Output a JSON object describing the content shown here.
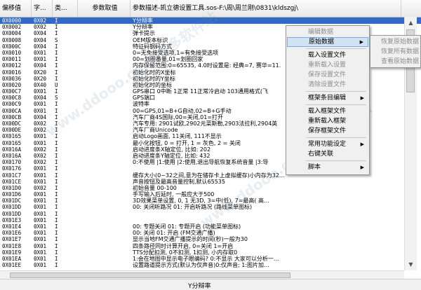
{
  "header": {
    "col0": "偏移值",
    "col1": "字...",
    "col2": "类...",
    "col3": "参数取值",
    "col4": "参数描述-凯立德设置工具.sos-F:\\周\\周兰刚\\0831\\kldszgj\\"
  },
  "rows": [
    {
      "offset": "0X0000",
      "size": "0X02",
      "type": "I",
      "value": "",
      "desc": "Y分辩率"
    },
    {
      "offset": "0X0002",
      "size": "0X02",
      "type": "I",
      "value": "",
      "desc": "Y分辩率"
    },
    {
      "offset": "0X0004",
      "size": "0X04",
      "type": "I",
      "value": "",
      "desc": "弹卡提示"
    },
    {
      "offset": "0X0008",
      "size": "0X04",
      "type": "S",
      "value": "",
      "desc": "OEM版本标识"
    },
    {
      "offset": "0X000C",
      "size": "0X04",
      "type": "I",
      "value": "",
      "desc": "特征码钢码方式"
    },
    {
      "offset": "0X0010",
      "size": "0X01",
      "type": "I",
      "value": "",
      "desc": "0=无免接受选项,1=有免接受选项"
    },
    {
      "offset": "0X0011",
      "size": "0X01",
      "type": "I",
      "value": "",
      "desc": "00=划圈番量,01=划圈回家"
    },
    {
      "offset": "0X0012",
      "size": "0X04",
      "type": "I",
      "value": "",
      "desc": "内存保留范围:0=65535, 4.0时设置是: 经典=7, 赛华=11."
    },
    {
      "offset": "0X0016",
      "size": "0X20",
      "type": "I",
      "value": "",
      "desc": "初始化时的X坐标"
    },
    {
      "offset": "0X0036",
      "size": "0X20",
      "type": "I",
      "value": "",
      "desc": "初始化时的Y坐标"
    },
    {
      "offset": "0X0020",
      "size": "0X40",
      "type": "U",
      "value": "",
      "desc": "初始化时的坐标"
    },
    {
      "offset": "0X00C7",
      "size": "0X01",
      "type": "I",
      "value": "",
      "desc": "GPS串口 0中断 1正常 11正常冷启动 103通用格式(飞"
    },
    {
      "offset": "0X00C8",
      "size": "0X04",
      "type": "S",
      "value": "",
      "desc": "GPS端口"
    },
    {
      "offset": "0X00C9",
      "size": "0X01",
      "type": "I",
      "value": "",
      "desc": "波特率"
    },
    {
      "offset": "0X00CA",
      "size": "0X01",
      "type": "I",
      "value": "",
      "desc": "00=GPS,01=B+G自动,02=B+G手动"
    },
    {
      "offset": "0X00CB",
      "size": "0X04",
      "type": "I",
      "value": "",
      "desc": "汽车厂商4S国际,00=关闭,01=打开"
    },
    {
      "offset": "0X00DC",
      "size": "0X02",
      "type": "I",
      "value": "",
      "desc": "汽车专用: 2901试欧,2902元菜斯勒,2903法拉利,2904英"
    },
    {
      "offset": "0X00DE",
      "size": "0X02",
      "type": "I",
      "value": "",
      "desc": "汽车厂商Unicode"
    },
    {
      "offset": "0X0165",
      "size": "0X01",
      "type": "I",
      "value": "",
      "desc": "启动Logo画面, 11关闭, 111不显示"
    },
    {
      "offset": "0X0165",
      "size": "0X01",
      "type": "I",
      "value": "",
      "desc": "最小化按钮, 0 = 打开, 1 = 灰色, 2 = 关闭"
    },
    {
      "offset": "0X016A",
      "size": "0X02",
      "type": "I",
      "value": "",
      "desc": "启动进度条X轴定位, 比如: 202"
    },
    {
      "offset": "0X016A",
      "size": "0X02",
      "type": "I",
      "value": "",
      "desc": "启动进度条Y轴定位, 比如: 432"
    },
    {
      "offset": "0X0170",
      "size": "0X02",
      "type": "I",
      "value": "",
      "desc": "0:不使用 |1:使用 |2:使用,退出导航恢复系统音量 |3:导"
    },
    {
      "offset": "0X0176",
      "size": "0X01",
      "type": "I",
      "value": "",
      "desc": ""
    },
    {
      "offset": "0X01C7",
      "size": "0X01",
      "type": "I",
      "value": "",
      "desc": "缓存大小(0~32之间,意为在储存卡上虚拟缓存)小内存为32..."
    },
    {
      "offset": "0X01CE",
      "size": "0X01",
      "type": "I",
      "value": "",
      "desc": "声音按钮及最高音量控制,默认65535"
    },
    {
      "offset": "0X01D0",
      "size": "0X02",
      "type": "I",
      "value": "",
      "desc": "初始音量 00-100"
    },
    {
      "offset": "0X01D6",
      "size": "0X01",
      "type": "I",
      "value": "",
      "desc": "手写输入后延时, 一般应大于500"
    },
    {
      "offset": "0X01DC",
      "size": "0X01",
      "type": "I",
      "value": "",
      "desc": "3D效果菜单设置, 0, 1 无3D, 3=中(低), 7=最高( 高..."
    },
    {
      "offset": "0X01DD",
      "size": "0X01",
      "type": "I",
      "value": "",
      "desc": "00: 关闭听路况   01: 开启听路况 (路线菜单图标)"
    },
    {
      "offset": "0X01DD",
      "size": "0X01",
      "type": "I",
      "value": "",
      "desc": ""
    },
    {
      "offset": "0X01E3",
      "size": "0X01",
      "type": "I",
      "value": "",
      "desc": ""
    },
    {
      "offset": "0X01E4",
      "size": "0X01",
      "type": "I",
      "value": "",
      "desc": "00: 专题关闭  01: 专题开启  (功能菜单图标)"
    },
    {
      "offset": "0X01E6",
      "size": "0X01",
      "type": "I",
      "value": "",
      "desc": "00: 关闭   01: 开启  (FM交通广播)"
    },
    {
      "offset": "0X01E7",
      "size": "0X01",
      "type": "I",
      "value": "",
      "desc": "显示当地FM交通广播提示的时间(秒)一般为30"
    },
    {
      "offset": "0X01E8",
      "size": "0X01",
      "type": "I",
      "value": "",
      "desc": "四条路径同时计算开启, 0=关闭 1=开启"
    },
    {
      "offset": "0X01E9",
      "size": "0X01",
      "type": "I",
      "value": "",
      "desc": "TTS分配扣测, 0不扣测, 1扣测, 小内存取0"
    },
    {
      "offset": "0X01EA",
      "size": "0X01",
      "type": "I",
      "value": "",
      "desc": "1:会在地图中显示电子眼编码? 0:不显示  大家可以分析一..."
    },
    {
      "offset": "0X01EE",
      "size": "0X01",
      "type": "I",
      "value": "",
      "desc": "设置路道提示方式(默认为仅声音)0:仅声音; 1:图片加..."
    }
  ],
  "context_menu": {
    "items": [
      {
        "label": "编辑数据",
        "disabled": true,
        "submenu": false
      },
      {
        "label": "原始数据",
        "disabled": false,
        "submenu": true,
        "highlight": true
      },
      {
        "sep": true
      },
      {
        "label": "载入设置文件",
        "disabled": false,
        "submenu": false
      },
      {
        "label": "重新载入设置",
        "disabled": true,
        "submenu": false
      },
      {
        "label": "保存设置文件",
        "disabled": true,
        "submenu": false
      },
      {
        "label": "清除设置文件",
        "disabled": true,
        "submenu": false
      },
      {
        "sep": true
      },
      {
        "label": "框架条目编辑",
        "disabled": false,
        "submenu": true
      },
      {
        "sep": true
      },
      {
        "label": "载入框架文件",
        "disabled": false,
        "submenu": false
      },
      {
        "label": "重新载入框架",
        "disabled": false,
        "submenu": false
      },
      {
        "label": "保存框架文件",
        "disabled": false,
        "submenu": false
      },
      {
        "sep": true
      },
      {
        "label": "常用功能设定",
        "disabled": false,
        "submenu": true
      },
      {
        "label": "右键关联",
        "disabled": false,
        "submenu": false
      },
      {
        "sep": true
      },
      {
        "label": "脚本",
        "disabled": false,
        "submenu": true
      }
    ]
  },
  "submenu": {
    "items": [
      "恢复原始数据",
      "恢复所有数据",
      "查看原始数据"
    ]
  },
  "status": {
    "text": "Y分辩率"
  },
  "watermark": {
    "text": "www.ddooo.com 多多软件站"
  },
  "colors": {
    "selection": "#316ac5",
    "menu_highlight": "#d1e2f2",
    "disabled_text": "#8d8d8d"
  }
}
